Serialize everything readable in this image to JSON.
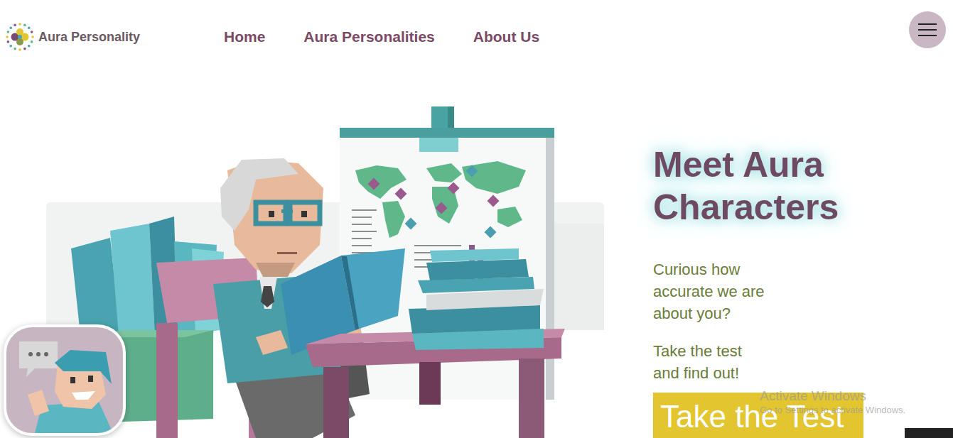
{
  "logo": {
    "text": "Aura Personality"
  },
  "nav": [
    {
      "label": "Home"
    },
    {
      "label": "Aura Personalities"
    },
    {
      "label": "About Us"
    }
  ],
  "hero": {
    "title": "Meet Aura Characters",
    "question": "Curious how accurate we are about you?",
    "cta_text": "Take the test and find out!",
    "button": "Take the Test"
  },
  "watermark": {
    "title": "Activate Windows",
    "subtitle": "Go to Settings to activate Windows."
  }
}
